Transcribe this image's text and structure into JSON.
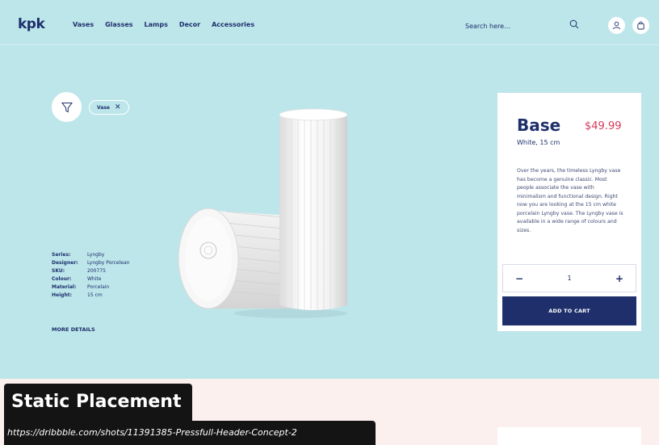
{
  "header": {
    "logo": "kpk",
    "nav": [
      "Vases",
      "Glasses",
      "Lamps",
      "Decor",
      "Accessories"
    ],
    "search_placeholder": "Search here...",
    "icons": {
      "search": "search-icon",
      "user": "user-icon",
      "cart": "shopping-bag-icon"
    }
  },
  "filter": {
    "icon": "filter-funnel-icon",
    "chip_label": "Vase",
    "chip_close": "✕"
  },
  "specs": [
    {
      "key": "Series:",
      "value": "Lyngby"
    },
    {
      "key": "Designer:",
      "value": "Lyngby Porcelean"
    },
    {
      "key": "SKU:",
      "value": "200775"
    },
    {
      "key": "Colour:",
      "value": "White"
    },
    {
      "key": "Material:",
      "value": "Porcelain"
    },
    {
      "key": "Height:",
      "value": "15 cm"
    }
  ],
  "more_details": "MORE DETAILS",
  "product": {
    "title": "Base",
    "price": "$49.99",
    "subtitle": "White, 15 cm",
    "description": "Over the years, the timeless Lyngby vase has become a genuine classic. Most people associate the vase with minimalism and functional design. Right now you are looking at the 15 cm white porcelain Lyngby vase. The Lyngby vase is available in a wide range of colours and sizes.",
    "quantity": "1",
    "minus": "−",
    "plus": "+",
    "add_to_cart": "ADD TO CART"
  },
  "overlay": {
    "title": "Static Placement",
    "url": "https://dribbble.com/shots/11391385-Pressfull-Header-Concept-2"
  },
  "colors": {
    "hero_bg": "#bde6eb",
    "brand_navy": "#1e2f6b",
    "price_red": "#d63a5a",
    "bottom_bg": "#fbf0ee"
  }
}
